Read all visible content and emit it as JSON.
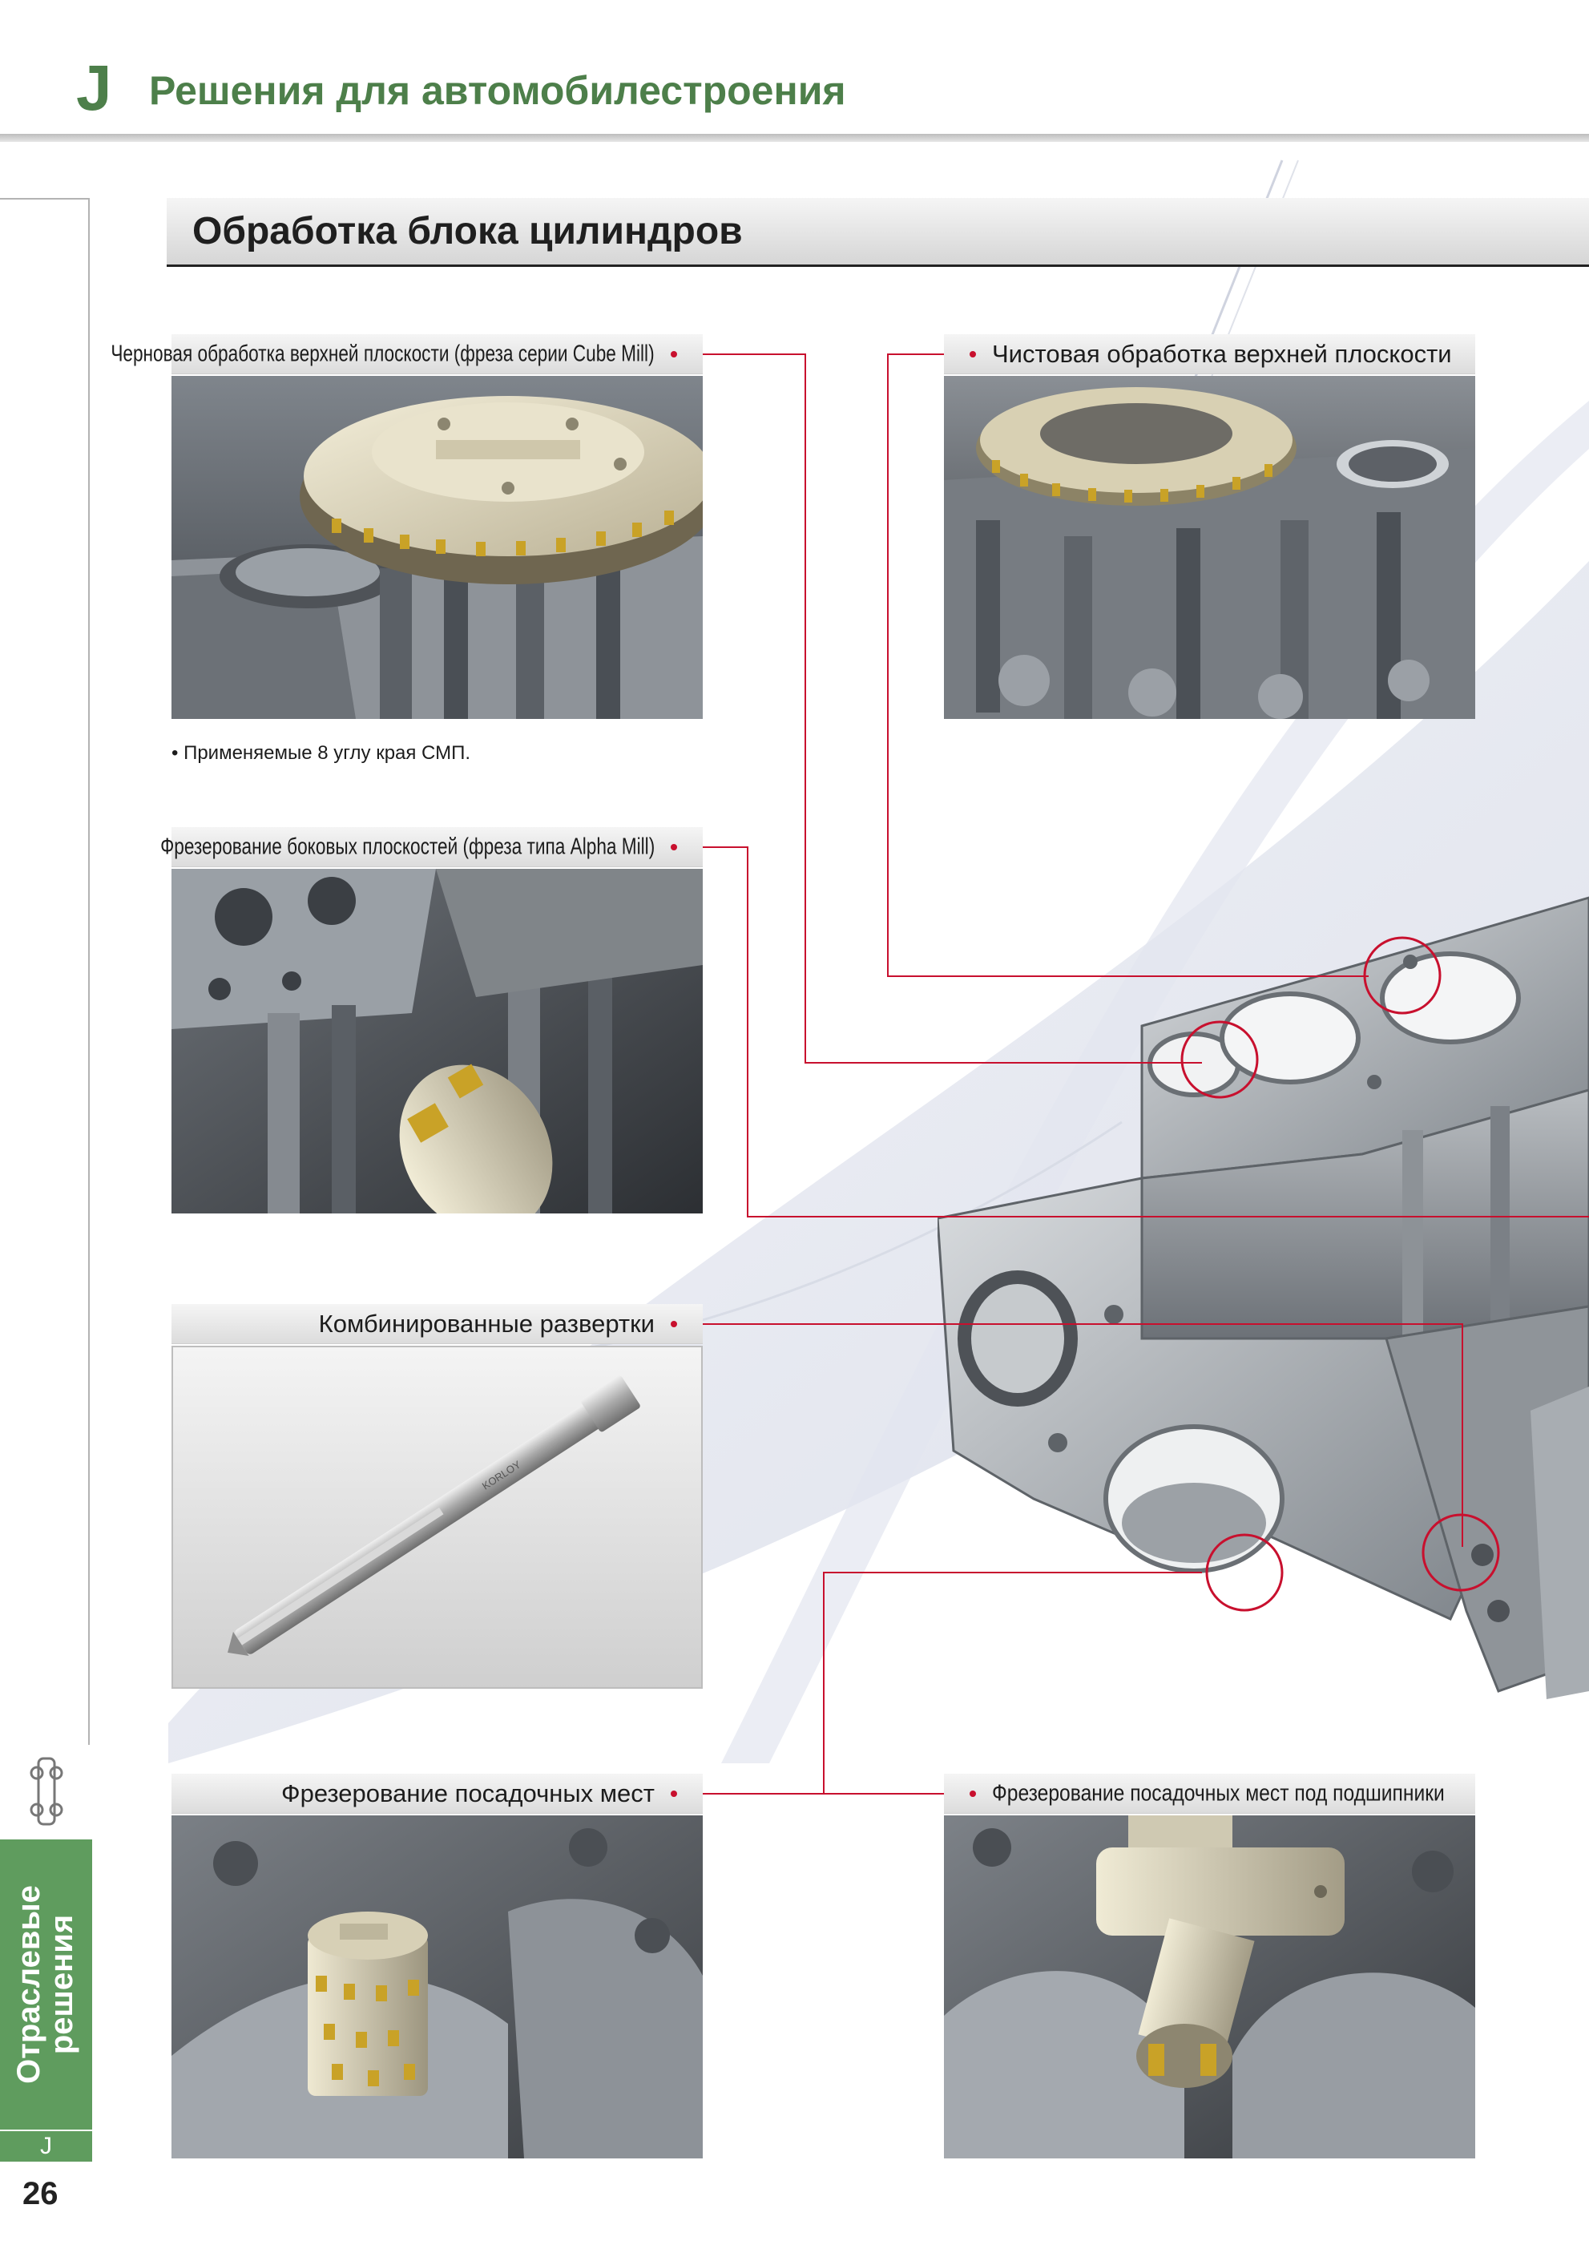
{
  "header": {
    "letter": "J",
    "title": "Решения для автомобилестроения"
  },
  "section": {
    "title": "Обработка блока цилиндров"
  },
  "operations": [
    {
      "caption": "Черновая обработка верхней плоскости (фреза серии Cube Mill)",
      "note": "• Применяемые 8 углу края СМП."
    },
    {
      "caption": "Чистовая обработка верхней плоскости"
    },
    {
      "caption": "Фрезерование боковых плоскостей (фреза типа Alpha Mill)"
    },
    {
      "caption": "Комбинированные развертки"
    },
    {
      "caption": "Фрезерование посадочных мест"
    },
    {
      "caption": "Фрезерование посадочных мест под подшипники"
    }
  ],
  "side_tab": {
    "label": "Отраслевые\nрешения",
    "letter": "J"
  },
  "page_number": "26",
  "tool_marking": "KORLOY",
  "colors": {
    "accent_green": "#4d7f4a",
    "tab_green": "#5f9c5e",
    "leader_red": "#c8102e"
  }
}
